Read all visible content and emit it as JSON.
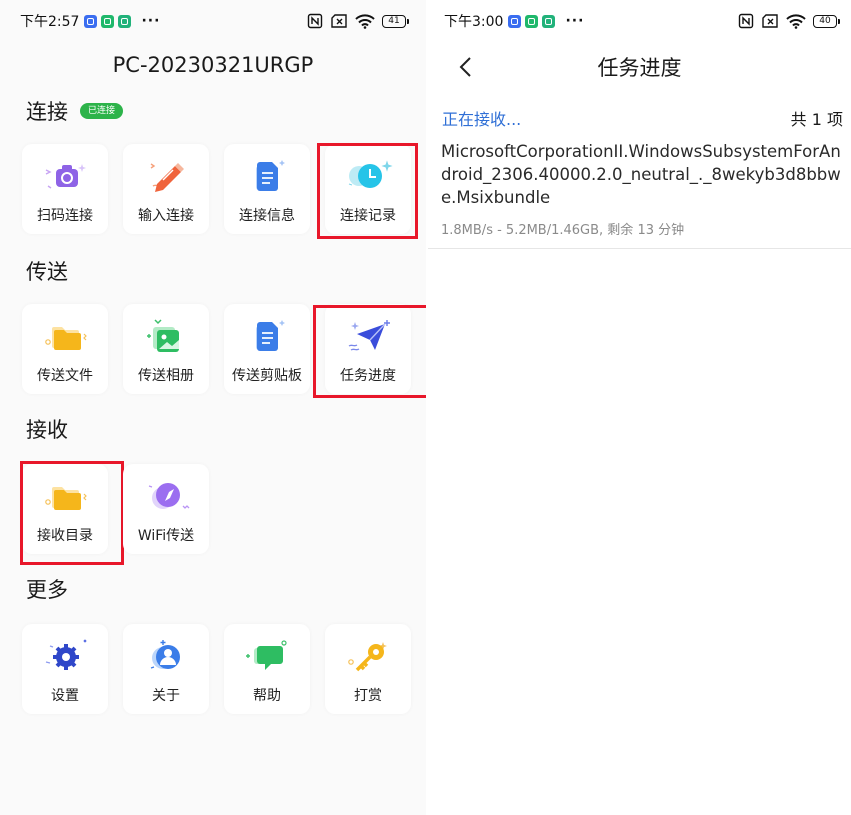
{
  "colors": {
    "accent_blue": "#2f6fd6",
    "badge_green": "#2db34a",
    "highlight_red": "#e8172a",
    "folder_yellow": "#f5b61b",
    "icon_purple": "#8e63e6"
  },
  "left_status": {
    "time": "下午2:57",
    "dots": "···",
    "battery": "41"
  },
  "right_status": {
    "time": "下午3:00",
    "dots": "···",
    "battery": "40"
  },
  "home": {
    "device_name": "PC-20230321URGP",
    "sections": {
      "connect": {
        "title": "连接",
        "badge": "已连接"
      },
      "send": {
        "title": "传送"
      },
      "receive": {
        "title": "接收"
      },
      "more": {
        "title": "更多"
      }
    },
    "tiles": {
      "scan_connect": {
        "label": "扫码连接",
        "icon": "camera-icon"
      },
      "input_connect": {
        "label": "输入连接",
        "icon": "pencil-icon"
      },
      "connect_info": {
        "label": "连接信息",
        "icon": "document-icon"
      },
      "connect_history": {
        "label": "连接记录",
        "icon": "clock-icon"
      },
      "send_file": {
        "label": "传送文件",
        "icon": "folder-icon"
      },
      "send_album": {
        "label": "传送相册",
        "icon": "photo-icon"
      },
      "send_clipboard": {
        "label": "传送剪贴板",
        "icon": "document-icon"
      },
      "task_progress": {
        "label": "任务进度",
        "icon": "paper-plane-icon"
      },
      "receive_dir": {
        "label": "接收目录",
        "icon": "folder-icon"
      },
      "wifi_send": {
        "label": "WiFi传送",
        "icon": "compass-icon"
      },
      "settings": {
        "label": "设置",
        "icon": "gear-icon"
      },
      "about": {
        "label": "关于",
        "icon": "person-icon"
      },
      "help": {
        "label": "帮助",
        "icon": "chat-icon"
      },
      "reward": {
        "label": "打赏",
        "icon": "key-icon"
      }
    }
  },
  "task": {
    "title": "任务进度",
    "status": "正在接收...",
    "count": "共 1 项",
    "file_name": "MicrosoftCorporationII.WindowsSubsystemForAndroid_2306.40000.2.0_neutral_._8wekyb3d8bbwe.Msixbundle",
    "progress_text": "1.8MB/s - 5.2MB/1.46GB, 剩余 13 分钟"
  }
}
